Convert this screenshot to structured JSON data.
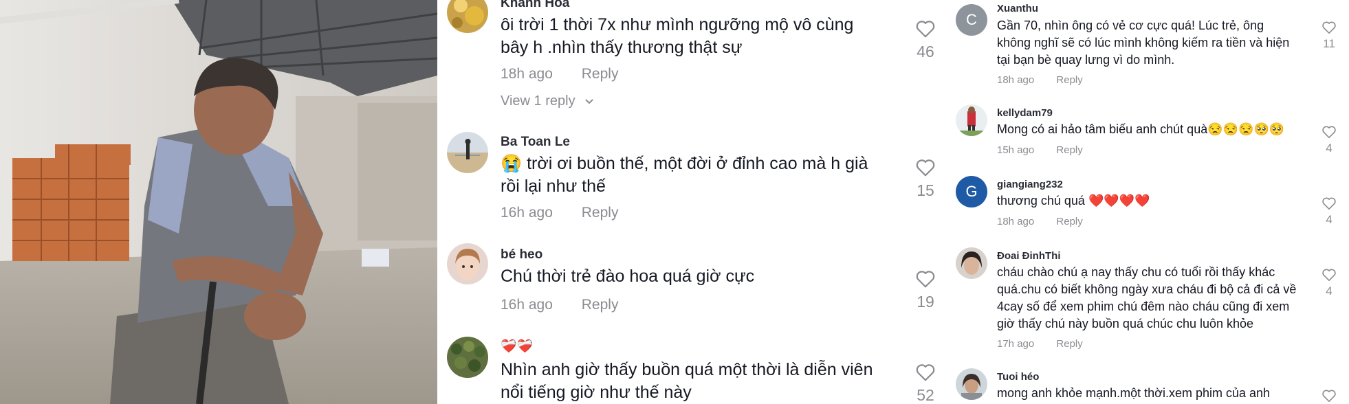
{
  "colors": {
    "accent_heart": "#e02b3c",
    "meta_gray": "#8a8b91",
    "text": "#161823",
    "avatar_c": "#8d949c",
    "avatar_g": "#1f5aa6"
  },
  "mid": {
    "comments": [
      {
        "name": "Khánh Hòa",
        "text": "ôi trời 1 thời 7x như mình ngưỡng mộ vô cùng bây h .nhìn thấy thương thật sự",
        "time": "18h ago",
        "reply": "Reply",
        "likes": "46",
        "view_reply": "View 1 reply"
      },
      {
        "name": "Ba Toan Le",
        "text": "😭 trời ơi buồn thế, một đời ở đỉnh cao mà h già rồi lại như thế",
        "time": "16h ago",
        "reply": "Reply",
        "likes": "15"
      },
      {
        "name": "bé heo",
        "text": "Chú thời trẻ đào hoa quá giờ cực",
        "time": "16h ago",
        "reply": "Reply",
        "likes": "19"
      },
      {
        "name": "❤️‍🩹❤️‍🩹",
        "text": "Nhìn anh giờ thấy buồn quá một thời là diễn viên nổi tiếng giờ như thế này",
        "likes": "52"
      }
    ]
  },
  "right": {
    "comments": [
      {
        "name": "Xuanthu",
        "avatar_letter": "C",
        "text": "Gần 70, nhìn ông có vẻ cơ cực quá! Lúc trẻ, ông không nghĩ sẽ có lúc mình không kiếm ra tiền và hiện tại bạn bè quay lưng vì do mình.",
        "time": "18h ago",
        "reply": "Reply",
        "likes": "11"
      },
      {
        "name": "kellydam79",
        "text": "Mong có ai hảo tâm biếu anh chút quà😒😒😒🥺🥺",
        "time": "15h ago",
        "reply": "Reply",
        "likes": "4"
      },
      {
        "name": "giangiang232",
        "avatar_letter": "G",
        "text": "thương chú quá ❤️❤️❤️❤️",
        "time": "18h ago",
        "reply": "Reply",
        "likes": "4"
      },
      {
        "name": "Đoai ĐinhThi",
        "text": "cháu chào chú ạ nay thấy chu có tuổi rồi thấy khác quá.chu có biết không ngày xưa cháu đi bộ cả đi cả về 4cay số để xem phim chú đêm nào cháu cũng đi xem giờ thấy chú này buồn quá chúc chu luôn khỏe",
        "time": "17h ago",
        "reply": "Reply",
        "likes": "4"
      },
      {
        "name": "Tuoi héo",
        "text": "mong anh khỏe mạnh.một thời.xem phim của anh"
      }
    ]
  }
}
